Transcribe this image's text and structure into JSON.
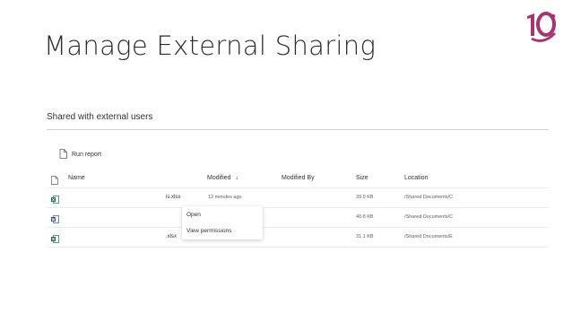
{
  "slide": {
    "title": "Manage External Sharing"
  },
  "logo": {
    "text": "10"
  },
  "section": {
    "title": "Shared with external users"
  },
  "toolbar": {
    "run_report_label": "Run report"
  },
  "table": {
    "headers": {
      "name": "Name",
      "modified": "Modified",
      "sort_indicator": "↓",
      "modified_by": "Modified By",
      "size": "Size",
      "location": "Location"
    },
    "rows": [
      {
        "icon": "excel-file-icon",
        "name_suffix": "is.xlsx",
        "modified": "12 minutes ago",
        "modified_by": "",
        "size": "39.9 KB",
        "location": "/Shared Documents/C"
      },
      {
        "icon": "word-file-icon",
        "name_suffix": "",
        "modified": "",
        "modified_by": "",
        "size": "40.8 KB",
        "location": "/Shared Documents/C"
      },
      {
        "icon": "excel-file-icon",
        "name_suffix": ".xlsx",
        "modified": "",
        "modified_by": "",
        "size": "31.1 KB",
        "location": "/Shared Documents/E"
      }
    ]
  },
  "context_menu": {
    "items": [
      {
        "label": "Open"
      },
      {
        "label": "View permissions"
      }
    ]
  },
  "colors": {
    "excel": "#1d6f42",
    "word": "#2b579a",
    "logo": "#a8336f",
    "divider": "#d2d0ce"
  }
}
